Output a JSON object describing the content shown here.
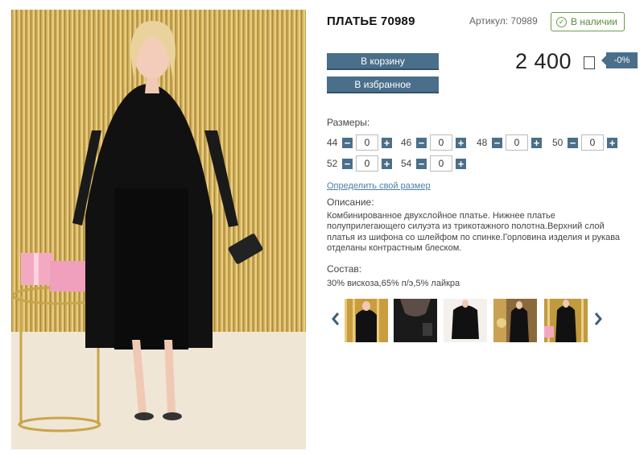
{
  "product": {
    "title": "ПЛАТЬЕ 70989",
    "sku": "Артикул: 70989",
    "stock_status": "В наличии"
  },
  "actions": {
    "cart_label": "В корзину",
    "favorites_label": "В избранное"
  },
  "price": {
    "value": "2 400",
    "discount": "-0%"
  },
  "sizes": {
    "label": "Размеры:",
    "items": [
      {
        "size": "44",
        "qty": "0"
      },
      {
        "size": "46",
        "qty": "0"
      },
      {
        "size": "48",
        "qty": "0"
      },
      {
        "size": "50",
        "qty": "0"
      },
      {
        "size": "52",
        "qty": "0"
      },
      {
        "size": "54",
        "qty": "0"
      }
    ],
    "find_size_link": "Определить свой размер"
  },
  "description": {
    "label": "Описание:",
    "text": "Комбинированное  двухслойное платье. Нижнее платье полуприлегающего силуэта из трикотажного полотна.Верхний слой платья из шифона со шлейфом по спинке.Горловина изделия и рукава отделаны контрастным блеском."
  },
  "composition": {
    "label": "Состав:",
    "text": "30% вискоза,65% п/э,5% лайкра"
  },
  "gallery": {
    "thumbnail_count": 5
  },
  "colors": {
    "accent": "#4a6f8a",
    "stock_green": "#6b9e4a",
    "link": "#4a7fa8"
  }
}
